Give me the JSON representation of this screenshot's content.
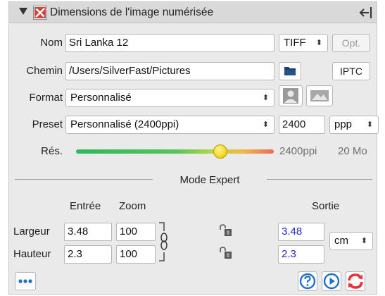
{
  "header": {
    "title": "Dimensions de l'image numérisée"
  },
  "file": {
    "name_label": "Nom",
    "name_value": "Sri Lanka 12",
    "format_select": "TIFF",
    "opt_button": "Opt.",
    "path_label": "Chemin",
    "path_value": "/Users/SilverFast/Pictures",
    "iptc_button": "IPTC"
  },
  "format": {
    "label": "Format",
    "value": "Personnalisé"
  },
  "preset": {
    "label": "Preset",
    "value": "Personnalisé (2400ppi)",
    "resolution_value": "2400",
    "unit": "ppp"
  },
  "resolution": {
    "label": "Rés.",
    "value_text": "2400ppi",
    "size_text": "20 Mo",
    "slider_fraction": 0.73
  },
  "expert": {
    "title": "Mode Expert",
    "input_header": "Entrée",
    "zoom_header": "Zoom",
    "output_header": "Sortie",
    "width_label": "Largeur",
    "width_in": "3.48",
    "width_zoom": "100",
    "width_out": "3.48",
    "height_label": "Hauteur",
    "height_in": "2.3",
    "height_zoom": "100",
    "height_out": "2.3",
    "unit": "cm"
  },
  "colors": {
    "accent_blue": "#1f6fd1",
    "output_text": "#2424e6",
    "reset_red": "#e8333a"
  }
}
